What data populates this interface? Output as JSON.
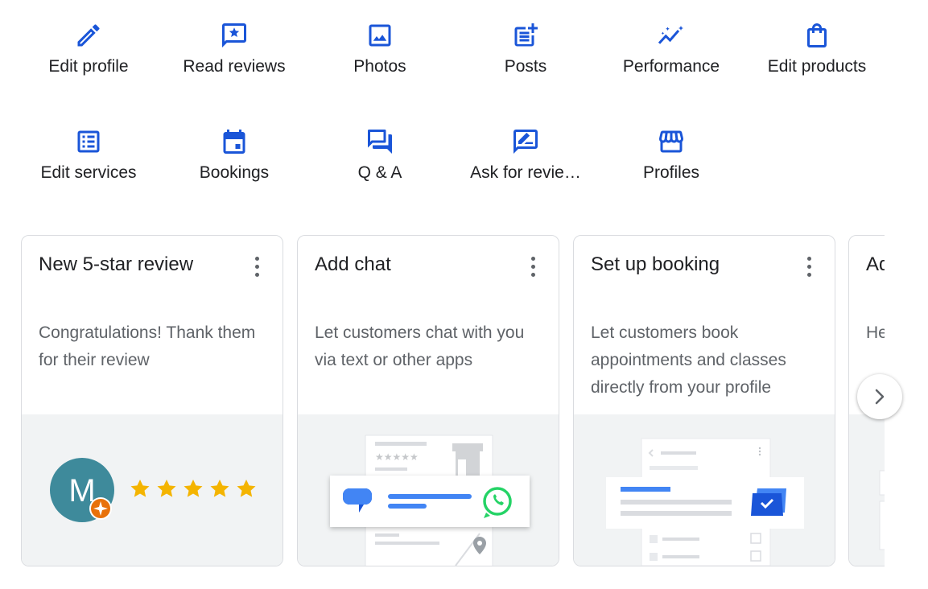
{
  "actions": [
    {
      "label": "Edit profile",
      "icon": "pencil-icon"
    },
    {
      "label": "Read reviews",
      "icon": "star-review-icon"
    },
    {
      "label": "Photos",
      "icon": "photo-icon"
    },
    {
      "label": "Posts",
      "icon": "post-add-icon"
    },
    {
      "label": "Performance",
      "icon": "performance-icon"
    },
    {
      "label": "Edit products",
      "icon": "shopping-bag-icon"
    },
    {
      "label": "Edit services",
      "icon": "list-icon"
    },
    {
      "label": "Bookings",
      "icon": "calendar-icon"
    },
    {
      "label": "Q & A",
      "icon": "forum-icon"
    },
    {
      "label": "Ask for revie…",
      "icon": "rate-review-icon"
    },
    {
      "label": "Profiles",
      "icon": "storefront-icon"
    }
  ],
  "cards": [
    {
      "title": "New 5-star review",
      "desc": "Congratulations! Thank them for their review",
      "avatar_letter": "M",
      "stars": 5
    },
    {
      "title": "Add chat",
      "desc": "Let customers chat with you via text or other apps"
    },
    {
      "title": "Set up booking",
      "desc": "Let customers book appointments and classes directly from your profile"
    },
    {
      "title": "Ad… we…",
      "desc": "He… ne…"
    }
  ],
  "colors": {
    "accent": "#1a55d8",
    "star": "#f4b400",
    "avatar": "#3e8a9b",
    "badge": "#e8710a",
    "whatsapp": "#25d366"
  }
}
